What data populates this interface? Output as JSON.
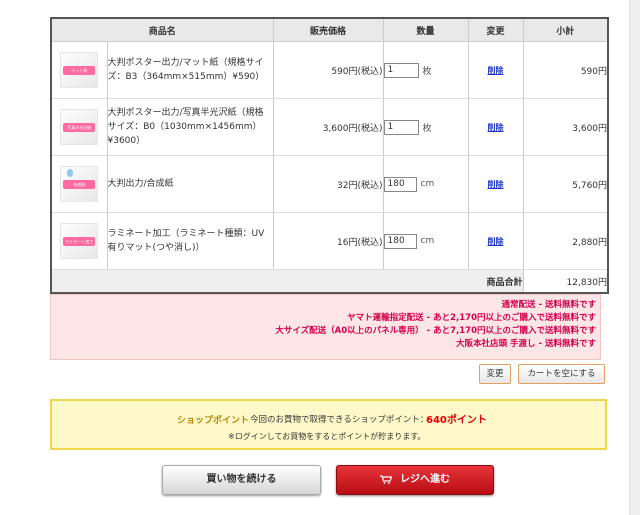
{
  "table": {
    "headers": [
      "商品名",
      "販売価格",
      "数量",
      "変更",
      "小計"
    ],
    "rows": [
      {
        "thumb_tag": "マット紙",
        "name": "大判ポスター出力/マット紙（規格サイズ：B3（364mm×515mm）¥590）",
        "price": "590円(税込)",
        "qty": "1",
        "unit": "枚",
        "action": "削除",
        "subtotal": "590円"
      },
      {
        "thumb_tag": "写真半光沢紙",
        "name": "大判ポスター出力/写真半光沢紙（規格サイズ：B0（1030mm×1456mm）¥3600）",
        "price": "3,600円(税込)",
        "qty": "1",
        "unit": "枚",
        "action": "削除",
        "subtotal": "3,600円"
      },
      {
        "thumb_tag": "合成紙",
        "name": "大判出力/合成紙",
        "price": "32円(税込)",
        "qty": "180",
        "unit": "cm",
        "action": "削除",
        "subtotal": "5,760円"
      },
      {
        "thumb_tag": "ラミネート加工",
        "name": "ラミネート加工（ラミネート種類：UV有りマット(つや消し)）",
        "price": "16円(税込)",
        "qty": "180",
        "unit": "cm",
        "action": "削除",
        "subtotal": "2,880円"
      }
    ],
    "total_label": "商品合計",
    "total_value": "12,830円"
  },
  "notice": {
    "lines": [
      "通常配送 - 送料無料です",
      "ヤマト運輸指定配送 - あと2,170円以上のご購入で送料無料です",
      "大サイズ配送（A0以上のパネル専用） - あと7,170円以上のご購入で送料無料です",
      "大阪本社店頭 手渡し - 送料無料です"
    ]
  },
  "buttons": {
    "change": "変更",
    "empty_cart": "カートを空にする",
    "continue_shopping": "買い物を続ける",
    "checkout": "レジへ進む"
  },
  "points": {
    "label": "ショップポイント",
    "desc": "今回のお買物で取得できるショップポイント：",
    "value": "640ポイント",
    "note": "※ログインしてお買物をするとポイントが貯まります。"
  },
  "colors": {
    "delete_link": "#1a36c6",
    "notice_text": "#d5004b",
    "points_value": "#e60000",
    "checkout_button": "#cc1f25"
  }
}
